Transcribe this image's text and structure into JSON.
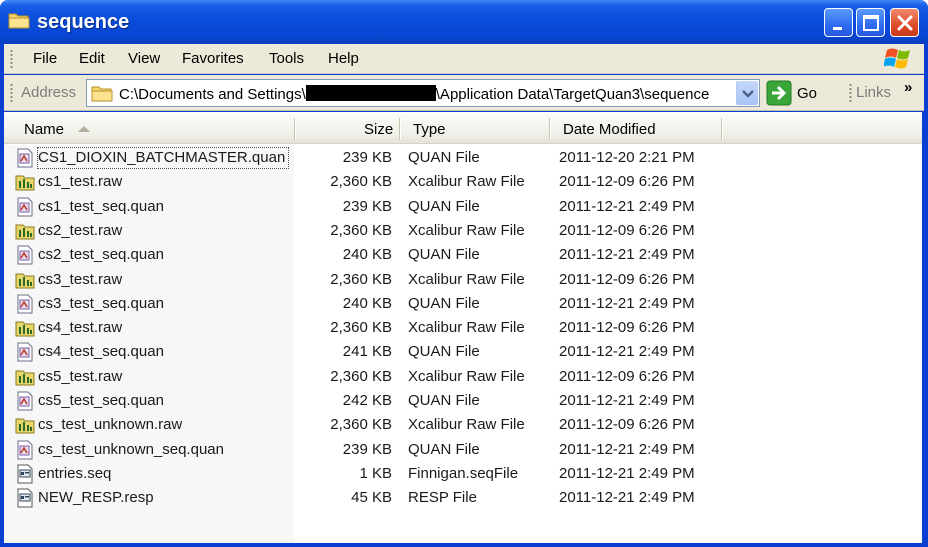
{
  "window": {
    "title": "sequence"
  },
  "menu": {
    "items": [
      {
        "label": "File"
      },
      {
        "label": "Edit"
      },
      {
        "label": "View"
      },
      {
        "label": "Favorites"
      },
      {
        "label": "Tools"
      },
      {
        "label": "Help"
      }
    ]
  },
  "address": {
    "label": "Address",
    "path_prefix": "C:\\Documents and Settings\\",
    "path_suffix": "\\Application Data\\TargetQuan3\\sequence",
    "go_label": "Go",
    "links_label": "Links",
    "links_chevron": "»"
  },
  "columns": {
    "name": "Name",
    "size": "Size",
    "type": "Type",
    "date": "Date Modified"
  },
  "files": [
    {
      "name": "CS1_DIOXIN_BATCHMASTER.quan",
      "size": "239 KB",
      "type": "QUAN File",
      "date": "2011-12-20 2:21 PM",
      "icon": "quan-file-icon"
    },
    {
      "name": "cs1_test.raw",
      "size": "2,360 KB",
      "type": "Xcalibur Raw File",
      "date": "2011-12-09 6:26 PM",
      "icon": "raw-file-icon"
    },
    {
      "name": "cs1_test_seq.quan",
      "size": "239 KB",
      "type": "QUAN File",
      "date": "2011-12-21 2:49 PM",
      "icon": "quan-file-icon"
    },
    {
      "name": "cs2_test.raw",
      "size": "2,360 KB",
      "type": "Xcalibur Raw File",
      "date": "2011-12-09 6:26 PM",
      "icon": "raw-file-icon"
    },
    {
      "name": "cs2_test_seq.quan",
      "size": "240 KB",
      "type": "QUAN File",
      "date": "2011-12-21 2:49 PM",
      "icon": "quan-file-icon"
    },
    {
      "name": "cs3_test.raw",
      "size": "2,360 KB",
      "type": "Xcalibur Raw File",
      "date": "2011-12-09 6:26 PM",
      "icon": "raw-file-icon"
    },
    {
      "name": "cs3_test_seq.quan",
      "size": "240 KB",
      "type": "QUAN File",
      "date": "2011-12-21 2:49 PM",
      "icon": "quan-file-icon"
    },
    {
      "name": "cs4_test.raw",
      "size": "2,360 KB",
      "type": "Xcalibur Raw File",
      "date": "2011-12-09 6:26 PM",
      "icon": "raw-file-icon"
    },
    {
      "name": "cs4_test_seq.quan",
      "size": "241 KB",
      "type": "QUAN File",
      "date": "2011-12-21 2:49 PM",
      "icon": "quan-file-icon"
    },
    {
      "name": "cs5_test.raw",
      "size": "2,360 KB",
      "type": "Xcalibur Raw File",
      "date": "2011-12-09 6:26 PM",
      "icon": "raw-file-icon"
    },
    {
      "name": "cs5_test_seq.quan",
      "size": "242 KB",
      "type": "QUAN File",
      "date": "2011-12-21 2:49 PM",
      "icon": "quan-file-icon"
    },
    {
      "name": "cs_test_unknown.raw",
      "size": "2,360 KB",
      "type": "Xcalibur Raw File",
      "date": "2011-12-09 6:26 PM",
      "icon": "raw-file-icon"
    },
    {
      "name": "cs_test_unknown_seq.quan",
      "size": "239 KB",
      "type": "QUAN File",
      "date": "2011-12-21 2:49 PM",
      "icon": "quan-file-icon"
    },
    {
      "name": "entries.seq",
      "size": "1 KB",
      "type": "Finnigan.seqFile",
      "date": "2011-12-21 2:49 PM",
      "icon": "seq-file-icon"
    },
    {
      "name": "NEW_RESP.resp",
      "size": "45 KB",
      "type": "RESP File",
      "date": "2011-12-21 2:49 PM",
      "icon": "seq-file-icon"
    }
  ],
  "colors": {
    "titlebar": "#0a4fdc",
    "chrome": "#ece9d8",
    "go_green": "#3aa63a"
  }
}
